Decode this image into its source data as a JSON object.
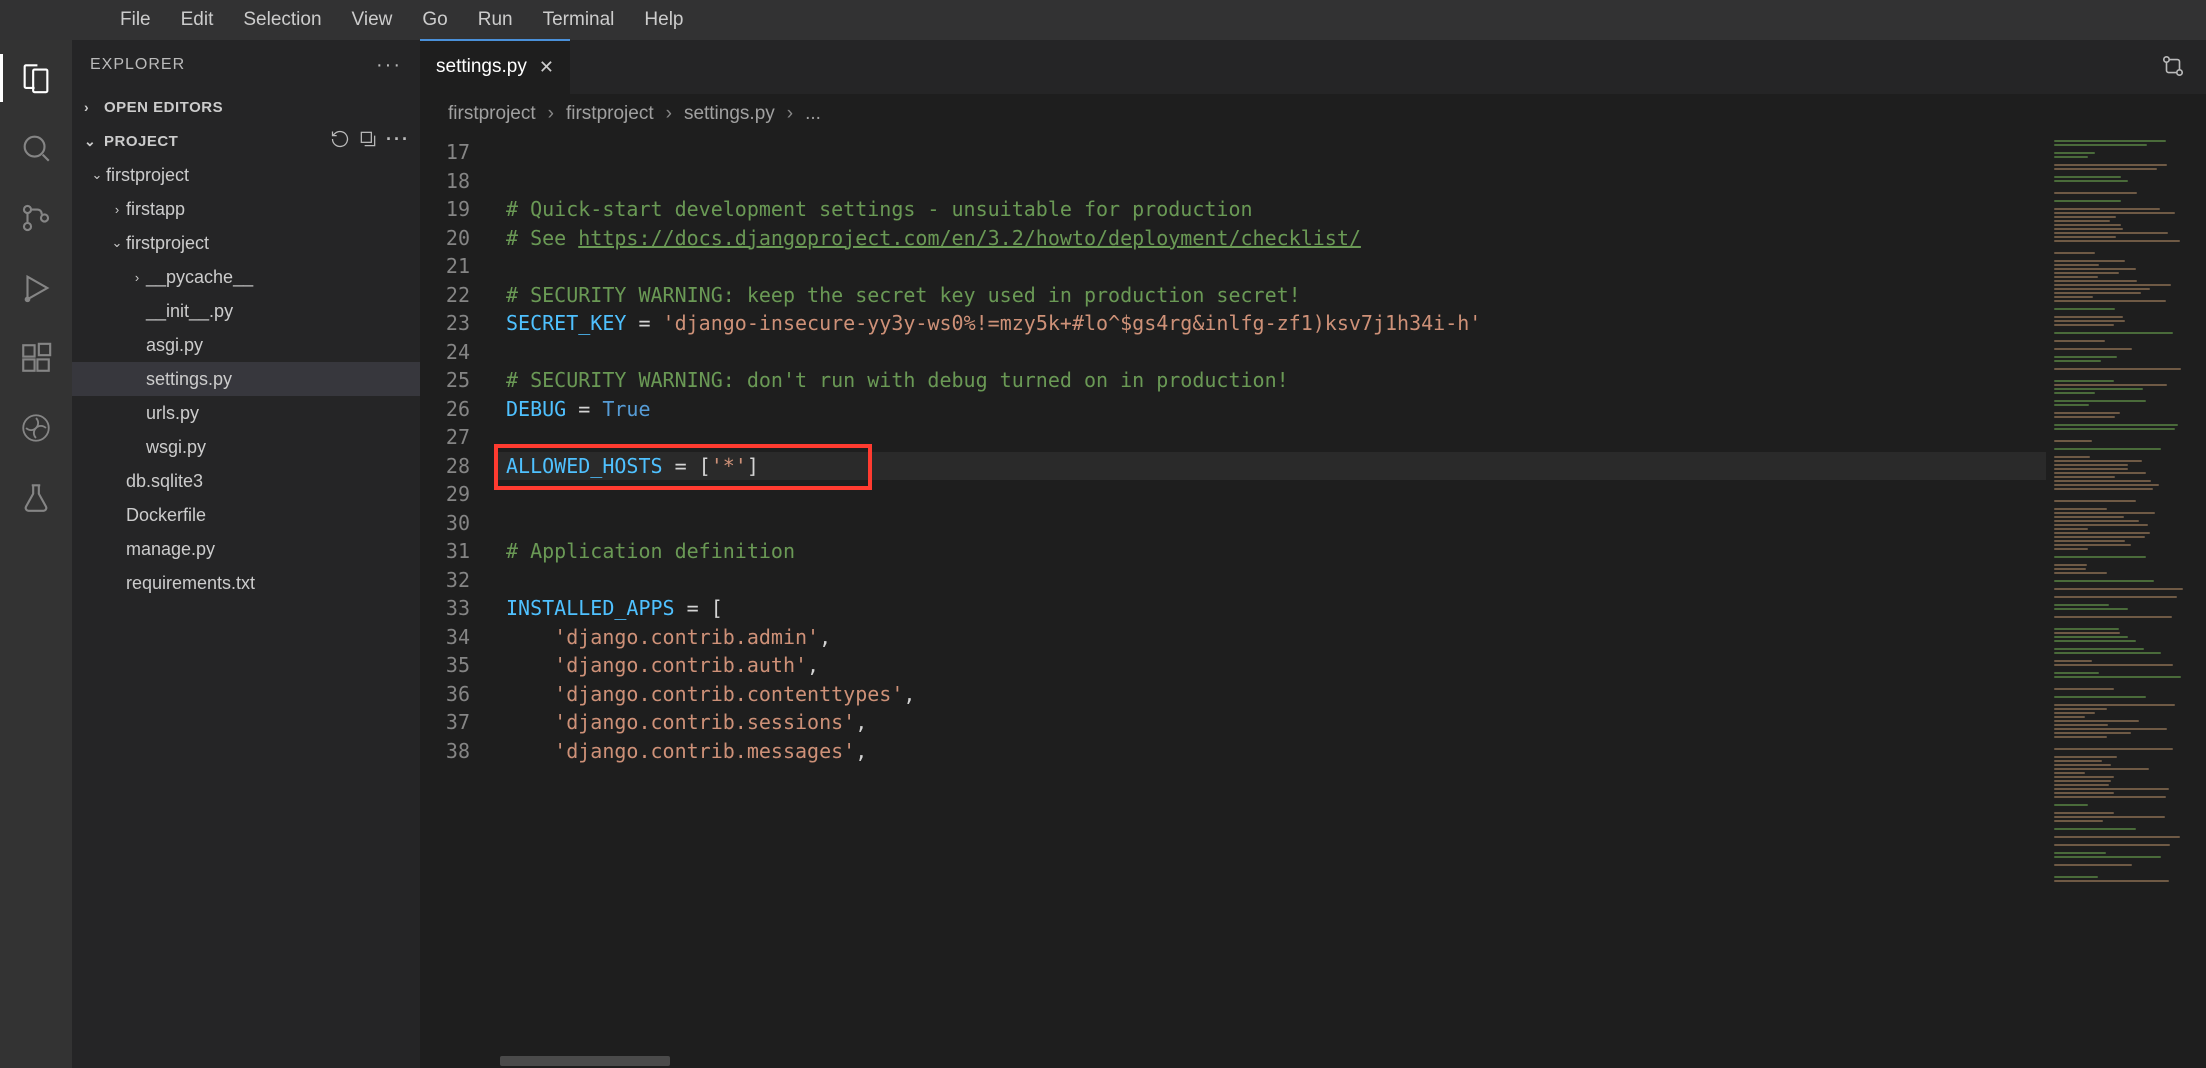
{
  "menubar": [
    "File",
    "Edit",
    "Selection",
    "View",
    "Go",
    "Run",
    "Terminal",
    "Help"
  ],
  "sidebar": {
    "title": "EXPLORER",
    "sections": {
      "openEditors": "OPEN EDITORS",
      "project": "PROJECT"
    },
    "tree": [
      {
        "label": "firstproject",
        "depth": 0,
        "expander": "v"
      },
      {
        "label": "firstapp",
        "depth": 1,
        "expander": ">"
      },
      {
        "label": "firstproject",
        "depth": 1,
        "expander": "v"
      },
      {
        "label": "__pycache__",
        "depth": 2,
        "expander": ">"
      },
      {
        "label": "__init__.py",
        "depth": 2,
        "expander": ""
      },
      {
        "label": "asgi.py",
        "depth": 2,
        "expander": ""
      },
      {
        "label": "settings.py",
        "depth": 2,
        "expander": "",
        "active": true
      },
      {
        "label": "urls.py",
        "depth": 2,
        "expander": ""
      },
      {
        "label": "wsgi.py",
        "depth": 2,
        "expander": ""
      },
      {
        "label": "db.sqlite3",
        "depth": 1,
        "expander": ""
      },
      {
        "label": "Dockerfile",
        "depth": 1,
        "expander": ""
      },
      {
        "label": "manage.py",
        "depth": 1,
        "expander": ""
      },
      {
        "label": "requirements.txt",
        "depth": 1,
        "expander": ""
      }
    ]
  },
  "tab": {
    "label": "settings.py"
  },
  "breadcrumbs": [
    "firstproject",
    "firstproject",
    "settings.py",
    "..."
  ],
  "code": {
    "firstLine": 17,
    "lines": [
      [],
      [],
      [
        {
          "cls": "tok-comment",
          "t": "# Quick-start development settings - unsuitable for production"
        }
      ],
      [
        {
          "cls": "tok-comment",
          "t": "# See "
        },
        {
          "cls": "tok-link",
          "t": "https://docs.djangoproject.com/en/3.2/howto/deployment/checklist/"
        }
      ],
      [],
      [
        {
          "cls": "tok-comment",
          "t": "# SECURITY WARNING: keep the secret key used in production secret!"
        }
      ],
      [
        {
          "cls": "tok-const",
          "t": "SECRET_KEY"
        },
        {
          "cls": "tok-op",
          "t": " = "
        },
        {
          "cls": "tok-string",
          "t": "'django-insecure-yy3y-ws0%!=mzy5k+#lo^$gs4rg&inlfg-zf1)ksv7j1h34i-h'"
        }
      ],
      [],
      [
        {
          "cls": "tok-comment",
          "t": "# SECURITY WARNING: don't run with debug turned on in production!"
        }
      ],
      [
        {
          "cls": "tok-const",
          "t": "DEBUG"
        },
        {
          "cls": "tok-op",
          "t": " = "
        },
        {
          "cls": "tok-keyword",
          "t": "True"
        }
      ],
      [],
      [
        {
          "cls": "tok-const",
          "t": "ALLOWED_HOSTS"
        },
        {
          "cls": "tok-op",
          "t": " = "
        },
        {
          "cls": "tok-punct",
          "t": "["
        },
        {
          "cls": "tok-string",
          "t": "'*'"
        },
        {
          "cls": "tok-punct",
          "t": "]"
        }
      ],
      [],
      [],
      [
        {
          "cls": "tok-comment",
          "t": "# Application definition"
        }
      ],
      [],
      [
        {
          "cls": "tok-const",
          "t": "INSTALLED_APPS"
        },
        {
          "cls": "tok-op",
          "t": " = "
        },
        {
          "cls": "tok-punct",
          "t": "["
        }
      ],
      [
        {
          "cls": "tok-punct",
          "t": "    "
        },
        {
          "cls": "tok-string",
          "t": "'django.contrib.admin'"
        },
        {
          "cls": "tok-punct",
          "t": ","
        }
      ],
      [
        {
          "cls": "tok-punct",
          "t": "    "
        },
        {
          "cls": "tok-string",
          "t": "'django.contrib.auth'"
        },
        {
          "cls": "tok-punct",
          "t": ","
        }
      ],
      [
        {
          "cls": "tok-punct",
          "t": "    "
        },
        {
          "cls": "tok-string",
          "t": "'django.contrib.contenttypes'"
        },
        {
          "cls": "tok-punct",
          "t": ","
        }
      ],
      [
        {
          "cls": "tok-punct",
          "t": "    "
        },
        {
          "cls": "tok-string",
          "t": "'django.contrib.sessions'"
        },
        {
          "cls": "tok-punct",
          "t": ","
        }
      ],
      [
        {
          "cls": "tok-punct",
          "t": "    "
        },
        {
          "cls": "tok-string",
          "t": "'django.contrib.messages'"
        },
        {
          "cls": "tok-punct",
          "t": ","
        }
      ]
    ],
    "currentIndex": 11
  }
}
